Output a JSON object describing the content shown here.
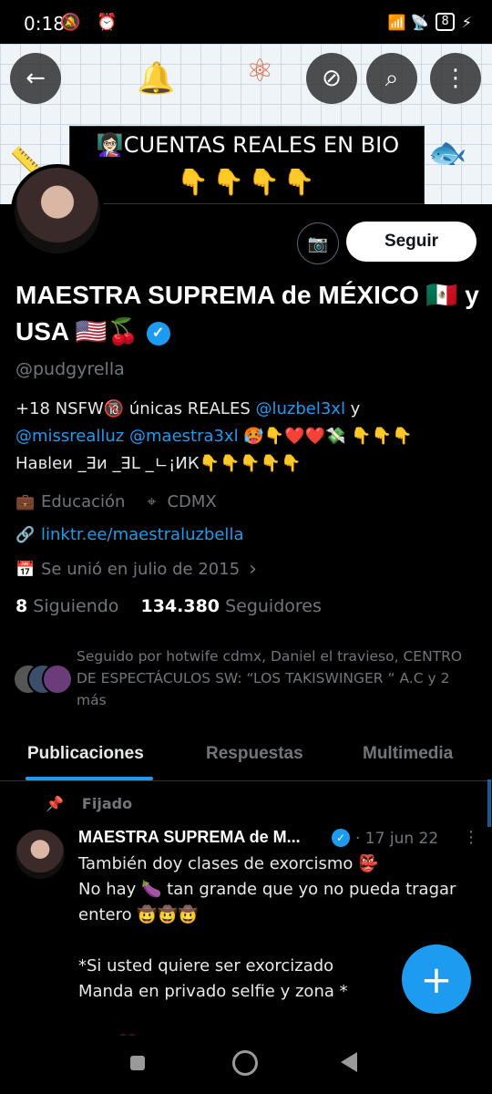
{
  "status_bar": {
    "time": "0:18",
    "left_icons": "🔕 ⏰",
    "right_icons": "📶 📡",
    "battery": "8",
    "charging": "⚡"
  },
  "header": {
    "back_icon": "←",
    "translate_icon": "⊘",
    "search_icon": "⌕",
    "more_icon": "⋮",
    "banner_line1": "👩🏻‍🏫CUENTAS REALES EN BIO",
    "banner_line2": "👇👇👇👇"
  },
  "profile": {
    "camera_icon": "📷",
    "follow_label": "Seguir",
    "name": "MAESTRA SUPREMA de MÉXICO 🇲🇽 y USA 🇺🇸🍒",
    "verified_icon": "✓",
    "handle": "@pudgyrella",
    "bio_part1": "+18 NSFW🔞 únicas REALES ",
    "bio_link1": "@luzbel3xl",
    "bio_part2": " y ",
    "bio_link2": "@missrealluz",
    "bio_part3": " ",
    "bio_link3": "@maestra3xl",
    "bio_part4": " 🥵👇❤️❤️💸 👇👇👇",
    "bio_line3": "Навlеи _ꓱи _ꓱL _ㄴ¡ИК👇👇👇👇👇",
    "category_icon": "💼",
    "category": "Educación",
    "location_icon": "⌖",
    "location": "CDMX",
    "link_icon": "🔗",
    "website": "linktr.ee/maestraluzbella",
    "joined_icon": "📅",
    "joined": "Se unió en julio de 2015",
    "joined_chevron": "›",
    "following_count": "8",
    "following_label": "Siguiendo",
    "followers_count": "134.380",
    "followers_label": "Seguidores",
    "followed_by": "Seguido por hotwife cdmx, Daniel el travieso, CENTRO DE ESPECTÁCULOS SW: “LOS TAKISWINGER “ A.C y 2 más"
  },
  "tabs": [
    {
      "label": "Publicaciones",
      "active": true
    },
    {
      "label": "Respuestas",
      "active": false
    },
    {
      "label": "Multimedia",
      "active": false
    }
  ],
  "pinned_tweet": {
    "pin_icon": "📌",
    "pinned_label": "Fijado",
    "author": "MAESTRA SUPREMA de M...",
    "date": "· 17 jun 22",
    "more_icon": "⋮",
    "text": "También doy clases de exorcismo 👺\nNo hay 🍆 tan grande que yo no pueda tragar entero 🤠🤠🤠\n\n*Si usted quiere ser exorcizado\nManda en privado selfie y zona *\n\nST... ❤️ ..."
  },
  "fab": {
    "icon": "+"
  },
  "colors": {
    "accent": "#1d9bf0",
    "background": "#000000",
    "muted": "#71767b"
  }
}
